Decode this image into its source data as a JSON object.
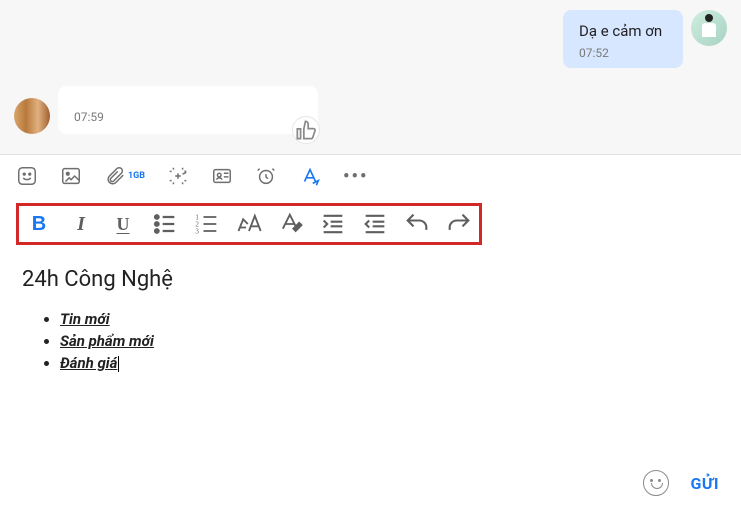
{
  "chat": {
    "outgoing": {
      "text": "Dạ e cảm ơn",
      "time": "07:52"
    },
    "incoming": {
      "time": "07:59"
    }
  },
  "toolbar": {
    "attach_label": "1GB"
  },
  "format": {
    "bold": "B",
    "italic": "I",
    "underline": "U"
  },
  "editor": {
    "title": "24h Công Nghệ",
    "items": [
      "Tin mới",
      "Sản phẩm mới",
      "Đánh giá"
    ]
  },
  "send": {
    "label": "GỬI"
  }
}
